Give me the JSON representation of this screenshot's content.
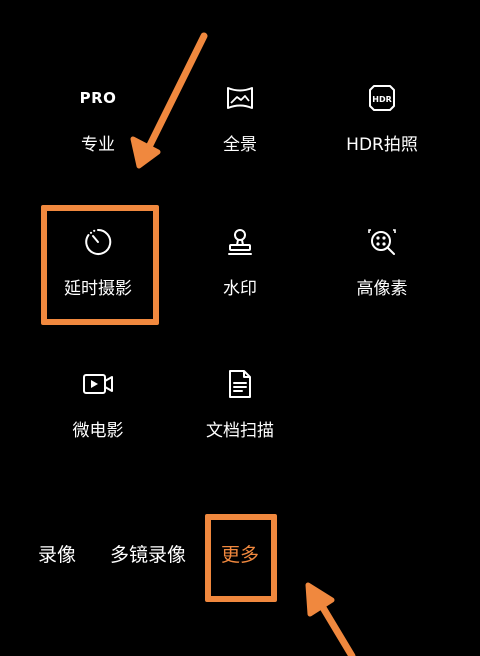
{
  "modes": [
    {
      "id": "pro",
      "label": "专业",
      "icon": "pro-icon",
      "icon_text": "PRO"
    },
    {
      "id": "panorama",
      "label": "全景",
      "icon": "panorama-icon"
    },
    {
      "id": "hdr",
      "label": "HDR拍照",
      "icon": "hdr-icon",
      "icon_text": "HDR"
    },
    {
      "id": "timelapse",
      "label": "延时摄影",
      "icon": "timer-icon"
    },
    {
      "id": "watermark",
      "label": "水印",
      "icon": "stamp-icon"
    },
    {
      "id": "high-res",
      "label": "高像素",
      "icon": "high-res-icon"
    },
    {
      "id": "micro-movie",
      "label": "微电影",
      "icon": "video-camera-icon"
    },
    {
      "id": "doc-scan",
      "label": "文档扫描",
      "icon": "document-icon"
    }
  ],
  "bottom_tabs": [
    {
      "id": "record",
      "label": "录像"
    },
    {
      "id": "multi-lens",
      "label": "多镜录像"
    },
    {
      "id": "more",
      "label": "更多",
      "active": true
    }
  ],
  "annotation": {
    "color": "#f0883e"
  },
  "colors": {
    "background": "#000000",
    "text": "#ffffff",
    "accent": "#f0883e"
  }
}
